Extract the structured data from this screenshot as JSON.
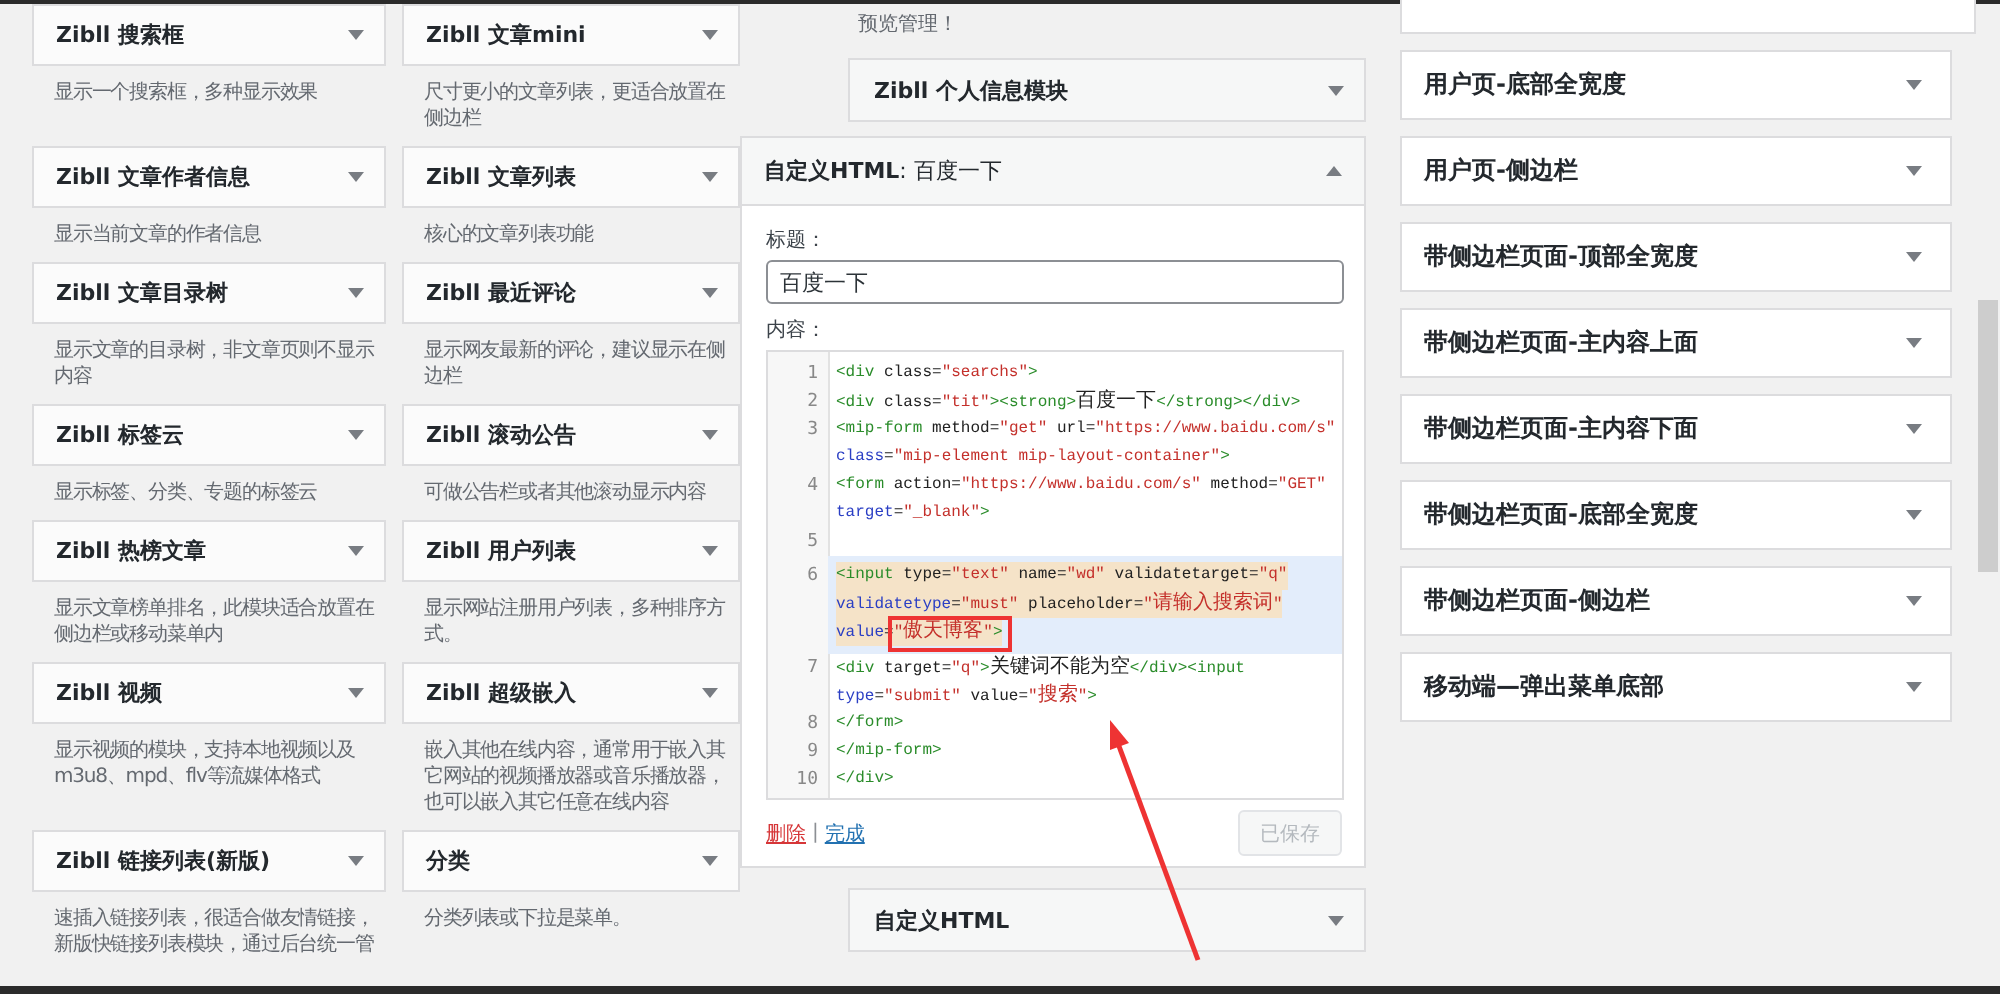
{
  "available_widgets": [
    {
      "title": "Zibll 搜索框",
      "description": "显示一个搜索框，多种显示效果"
    },
    {
      "title": "Zibll 文章mini",
      "description": "尺寸更小的文章列表，更适合放置在侧边栏"
    },
    {
      "title": "Zibll 文章作者信息",
      "description": "显示当前文章的作者信息"
    },
    {
      "title": "Zibll 文章列表",
      "description": "核心的文章列表功能"
    },
    {
      "title": "Zibll 文章目录树",
      "description": "显示文章的目录树，非文章页则不显示内容"
    },
    {
      "title": "Zibll 最近评论",
      "description": "显示网友最新的评论，建议显示在侧边栏"
    },
    {
      "title": "Zibll 标签云",
      "description": "显示标签、分类、专题的标签云"
    },
    {
      "title": "Zibll 滚动公告",
      "description": "可做公告栏或者其他滚动显示内容"
    },
    {
      "title": "Zibll 热榜文章",
      "description": "显示文章榜单排名，此模块适合放置在侧边栏或移动菜单内"
    },
    {
      "title": "Zibll 用户列表",
      "description": "显示网站注册用户列表，多种排序方式。"
    },
    {
      "title": "Zibll 视频",
      "description": "显示视频的模块，支持本地视频以及m3u8、mpd、flv等流媒体格式"
    },
    {
      "title": "Zibll 超级嵌入",
      "description": "嵌入其他在线内容，通常用于嵌入其它网站的视频播放器或音乐播放器，也可以嵌入其它任意在线内容"
    },
    {
      "title": "Zibll 链接列表(新版)",
      "description": "速插入链接列表，很适合做友情链接，新版快链接列表模块，通过后台统一管"
    },
    {
      "title": "分类",
      "description": "分类列表或下拉是菜单。"
    }
  ],
  "sidebar": {
    "note": "预览管理！",
    "widgets_above": [
      {
        "title": "Zibll 个人信息模块"
      }
    ],
    "open_widget": {
      "title": "自定义HTML",
      "title_separator": ":",
      "instance_title": "百度一下",
      "expanded": true,
      "title_label": "标题：",
      "title_value": "百度一下",
      "content_label": "内容：",
      "code_lines": [
        {
          "number": "1",
          "rows": [
            "<div class=\"searchs\">"
          ],
          "highlighted": false
        },
        {
          "number": "2",
          "rows": [
            "<div class=\"tit\"><strong>百度一下</strong></div>"
          ],
          "highlighted": false
        },
        {
          "number": "3",
          "rows": [
            "<mip-form method=\"get\" url=\"https://www.baidu.com/s\"",
            "class=\"mip-element mip-layout-container\">"
          ],
          "highlighted": false
        },
        {
          "number": "4",
          "rows": [
            "<form action=\"https://www.baidu.com/s\" method=\"GET\"",
            "target=\"_blank\">"
          ],
          "highlighted": false
        },
        {
          "number": "5",
          "highlighted": false
        },
        {
          "number": "6",
          "rows": [
            "<input type=\"text\" name=\"wd\" validatetarget=\"q\"",
            "validatetype=\"must\" placeholder=\"请输入搜索词\"",
            "value=\"傲天博客\">"
          ],
          "highlighted": true
        },
        {
          "number": "7",
          "rows": [
            "<div target=\"q\">关键词不能为空</div><input",
            "type=\"submit\" value=\"搜索\">"
          ],
          "highlighted": false
        },
        {
          "number": "8",
          "rows": [
            "</form>"
          ],
          "highlighted": false
        },
        {
          "number": "9",
          "rows": [
            "</mip-form>"
          ],
          "highlighted": false
        },
        {
          "number": "10",
          "rows": [
            "</div>"
          ],
          "highlighted": false
        }
      ],
      "delete_link": "删除",
      "separator": "|",
      "done_link": "完成",
      "save_button": {
        "label": "已保存",
        "disabled": true
      }
    },
    "widgets_below": [
      {
        "title": "自定义HTML"
      }
    ]
  },
  "widget_areas": [
    {
      "title": "用户页-底部全宽度"
    },
    {
      "title": "用户页-侧边栏"
    },
    {
      "title": "带侧边栏页面-顶部全宽度"
    },
    {
      "title": "带侧边栏页面-主内容上面"
    },
    {
      "title": "带侧边栏页面-主内容下面"
    },
    {
      "title": "带侧边栏页面-底部全宽度"
    },
    {
      "title": "带侧边栏页面-侧边栏"
    },
    {
      "title": "移动端—弹出菜单底部"
    }
  ]
}
